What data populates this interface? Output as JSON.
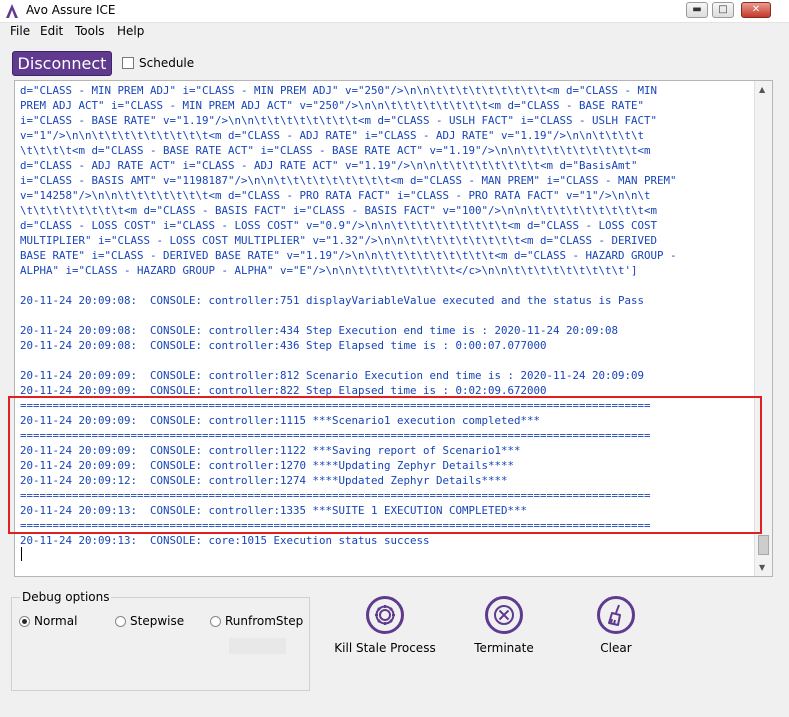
{
  "window": {
    "title": "Avo Assure ICE",
    "minimize_glyph": "▬",
    "maximize_glyph": "□",
    "close_glyph": "✕",
    "logo_icon": "avo-logo-icon"
  },
  "menu": [
    "File",
    "Edit",
    "Tools",
    "Help"
  ],
  "toolbar": {
    "disconnect_label": "Disconnect",
    "schedule_label": "Schedule",
    "schedule_checked": false
  },
  "console": {
    "lines": [
      "d=\"CLASS - MIN PREM ADJ\" i=\"CLASS - MIN PREM ADJ\" v=\"250\"/>\\n\\n\\t\\t\\t\\t\\t\\t\\t\\t\\t<m d=\"CLASS - MIN",
      "PREM ADJ ACT\" i=\"CLASS - MIN PREM ADJ ACT\" v=\"250\"/>\\n\\n\\t\\t\\t\\t\\t\\t\\t\\t<m d=\"CLASS - BASE RATE\"",
      "i=\"CLASS - BASE RATE\" v=\"1.19\"/>\\n\\n\\t\\t\\t\\t\\t\\t\\t\\t<m d=\"CLASS - USLH FACT\" i=\"CLASS - USLH FACT\"",
      "v=\"1\"/>\\n\\n\\t\\t\\t\\t\\t\\t\\t\\t\\t<m d=\"CLASS - ADJ RATE\" i=\"CLASS - ADJ RATE\" v=\"1.19\"/>\\n\\n\\t\\t\\t\\t",
      "\\t\\t\\t\\t<m d=\"CLASS - BASE RATE ACT\" i=\"CLASS - BASE RATE ACT\" v=\"1.19\"/>\\n\\n\\t\\t\\t\\t\\t\\t\\t\\t\\t<m",
      "d=\"CLASS - ADJ RATE ACT\" i=\"CLASS - ADJ RATE ACT\" v=\"1.19\"/>\\n\\n\\t\\t\\t\\t\\t\\t\\t\\t<m d=\"BasisAmt\"",
      "i=\"CLASS - BASIS AMT\" v=\"1198187\"/>\\n\\n\\t\\t\\t\\t\\t\\t\\t\\t\\t<m d=\"CLASS - MAN PREM\" i=\"CLASS - MAN PREM\"",
      "v=\"14258\"/>\\n\\n\\t\\t\\t\\t\\t\\t\\t<m d=\"CLASS - PRO RATA FACT\" i=\"CLASS - PRO RATA FACT\" v=\"1\"/>\\n\\n\\t",
      "\\t\\t\\t\\t\\t\\t\\t\\t<m d=\"CLASS - BASIS FACT\" i=\"CLASS - BASIS FACT\" v=\"100\"/>\\n\\n\\t\\t\\t\\t\\t\\t\\t\\t\\t<m",
      "d=\"CLASS - LOSS COST\" i=\"CLASS - LOSS COST\" v=\"0.9\"/>\\n\\n\\t\\t\\t\\t\\t\\t\\t\\t\\t<m d=\"CLASS - LOSS COST",
      "MULTIPLIER\" i=\"CLASS - LOSS COST MULTIPLIER\" v=\"1.32\"/>\\n\\n\\t\\t\\t\\t\\t\\t\\t\\t\\t<m d=\"CLASS - DERIVED",
      "BASE RATE\" i=\"CLASS - DERIVED BASE RATE\" v=\"1.19\"/>\\n\\n\\t\\t\\t\\t\\t\\t\\t\\t\\t<m d=\"CLASS - HAZARD GROUP -",
      "ALPHA\" i=\"CLASS - HAZARD GROUP - ALPHA\" v=\"E\"/>\\n\\n\\t\\t\\t\\t\\t\\t\\t\\t</c>\\n\\n\\t\\t\\t\\t\\t\\t\\t\\t\\t']",
      "",
      "20-11-24 20:09:08:  CONSOLE: controller:751 displayVariableValue executed and the status is Pass",
      "",
      "20-11-24 20:09:08:  CONSOLE: controller:434 Step Execution end time is : 2020-11-24 20:09:08",
      "20-11-24 20:09:08:  CONSOLE: controller:436 Step Elapsed time is : 0:00:07.077000",
      "",
      "20-11-24 20:09:09:  CONSOLE: controller:812 Scenario Execution end time is : 2020-11-24 20:09:09",
      "20-11-24 20:09:09:  CONSOLE: controller:822 Step Elapsed time is : 0:02:09.672000",
      "=================================================================================================",
      "20-11-24 20:09:09:  CONSOLE: controller:1115 ***Scenario1 execution completed***",
      "=================================================================================================",
      "20-11-24 20:09:09:  CONSOLE: controller:1122 ***Saving report of Scenario1***",
      "20-11-24 20:09:09:  CONSOLE: controller:1270 ****Updating Zephyr Details****",
      "20-11-24 20:09:12:  CONSOLE: controller:1274 ****Updated Zephyr Details****",
      "=================================================================================================",
      "20-11-24 20:09:13:  CONSOLE: controller:1335 ***SUITE 1 EXECUTION COMPLETED***",
      "=================================================================================================",
      "20-11-24 20:09:13:  CONSOLE: core:1015 Execution status success"
    ]
  },
  "debug": {
    "legend": "Debug options",
    "options": [
      "Normal",
      "Stepwise",
      "RunfromStep"
    ],
    "selected": "Normal",
    "step_value": ""
  },
  "actions": [
    {
      "label": "Kill Stale Process",
      "icon": "gear-icon"
    },
    {
      "label": "Terminate",
      "icon": "cancel-circle-icon"
    },
    {
      "label": "Clear",
      "icon": "broom-icon"
    }
  ],
  "colors": {
    "accent": "#5f3a8f",
    "console_text": "#1744b8",
    "highlight": "#e02020"
  }
}
